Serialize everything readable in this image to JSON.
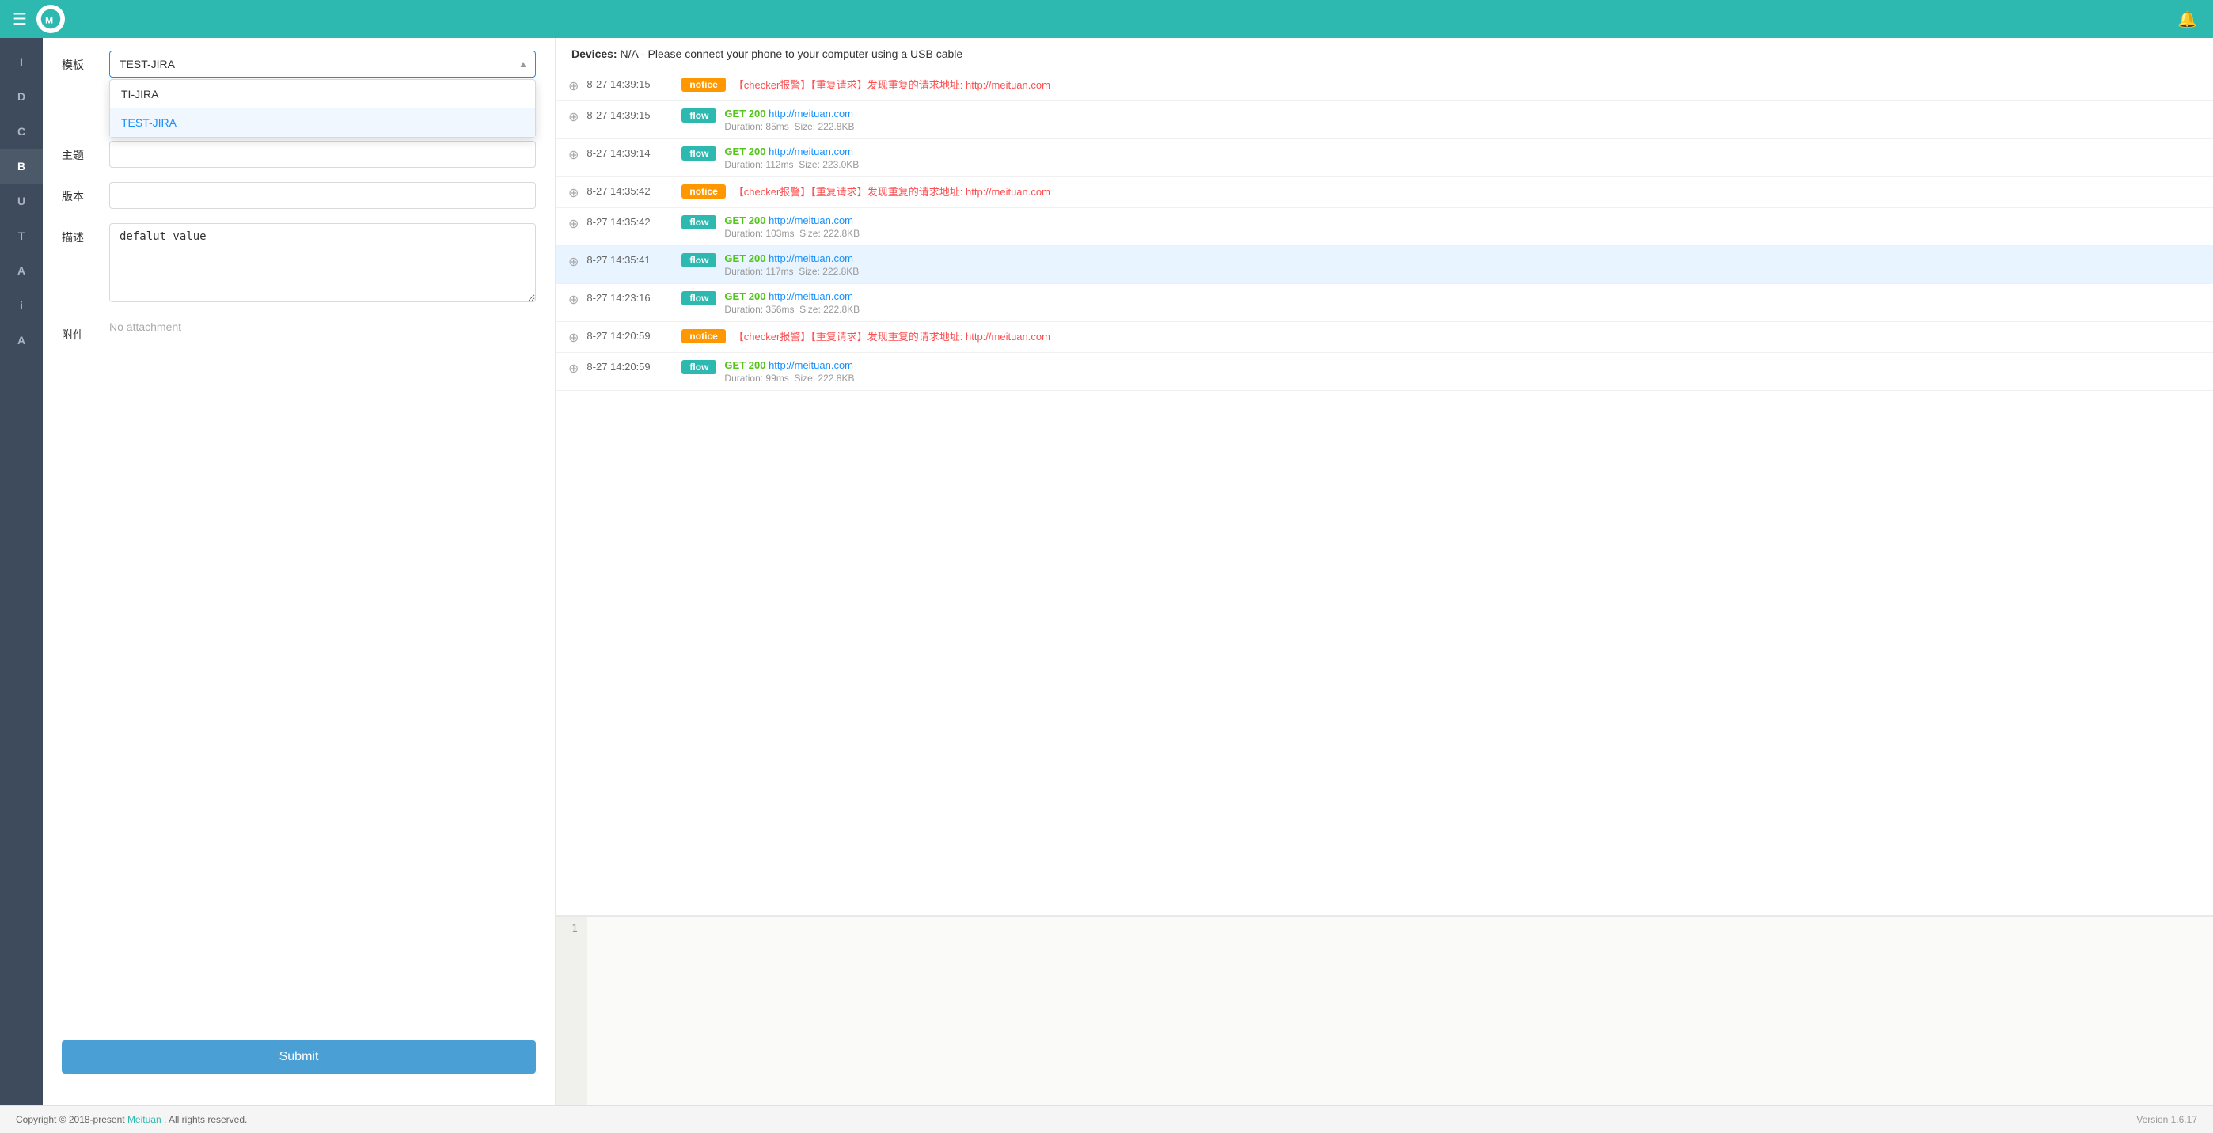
{
  "topbar": {
    "menu_icon": "☰",
    "bell_icon": "🔔"
  },
  "sidebar": {
    "items": [
      {
        "label": "I",
        "id": "i1",
        "active": false
      },
      {
        "label": "D",
        "id": "d",
        "active": false
      },
      {
        "label": "C",
        "id": "c",
        "active": false
      },
      {
        "label": "B",
        "id": "b",
        "active": true
      },
      {
        "label": "U",
        "id": "u",
        "active": false
      },
      {
        "label": "T",
        "id": "t",
        "active": false
      },
      {
        "label": "A",
        "id": "a1",
        "active": false
      },
      {
        "label": "i",
        "id": "i2",
        "active": false
      },
      {
        "label": "A",
        "id": "a2",
        "active": false
      }
    ]
  },
  "form": {
    "template_label": "模板",
    "template_value": "TEST-JIRA",
    "dropdown_items": [
      {
        "label": "TI-JIRA",
        "selected": false
      },
      {
        "label": "TEST-JIRA",
        "selected": true
      }
    ],
    "subject_label": "主题",
    "subject_value": "",
    "version_label": "版本",
    "version_value": "",
    "desc_label": "描述",
    "desc_value": "defalut value",
    "attach_label": "附件",
    "attach_placeholder": "No attachment",
    "submit_label": "Submit"
  },
  "device_bar": {
    "label": "Devices:",
    "message": "N/A - Please connect your phone to your computer using a USB cable"
  },
  "network_items": [
    {
      "id": 1,
      "timestamp": "8-27 14:39:15",
      "badge_type": "notice",
      "badge_label": "notice",
      "is_notice": true,
      "notice_text": "【checker报警】【重复请求】发现重复的请求地址: http://meituan.com",
      "highlighted": false
    },
    {
      "id": 2,
      "timestamp": "8-27 14:39:15",
      "badge_type": "flow",
      "badge_label": "flow",
      "is_notice": false,
      "method": "GET",
      "status": "200",
      "url": "http://meituan.com",
      "duration": "Duration: 85ms",
      "size": "Size: 222.8KB",
      "highlighted": false
    },
    {
      "id": 3,
      "timestamp": "8-27 14:39:14",
      "badge_type": "flow",
      "badge_label": "flow",
      "is_notice": false,
      "method": "GET",
      "status": "200",
      "url": "http://meituan.com",
      "duration": "Duration: 112ms",
      "size": "Size: 223.0KB",
      "highlighted": false
    },
    {
      "id": 4,
      "timestamp": "8-27 14:35:42",
      "badge_type": "notice",
      "badge_label": "notice",
      "is_notice": true,
      "notice_text": "【checker报警】【重复请求】发现重复的请求地址: http://meituan.com",
      "highlighted": false
    },
    {
      "id": 5,
      "timestamp": "8-27 14:35:42",
      "badge_type": "flow",
      "badge_label": "flow",
      "is_notice": false,
      "method": "GET",
      "status": "200",
      "url": "http://meituan.com",
      "duration": "Duration: 103ms",
      "size": "Size: 222.8KB",
      "highlighted": false
    },
    {
      "id": 6,
      "timestamp": "8-27 14:35:41",
      "badge_type": "flow",
      "badge_label": "flow",
      "is_notice": false,
      "method": "GET",
      "status": "200",
      "url": "http://meituan.com",
      "duration": "Duration: 117ms",
      "size": "Size: 222.8KB",
      "highlighted": true
    },
    {
      "id": 7,
      "timestamp": "8-27 14:23:16",
      "badge_type": "flow",
      "badge_label": "flow",
      "is_notice": false,
      "method": "GET",
      "status": "200",
      "url": "http://meituan.com",
      "duration": "Duration: 356ms",
      "size": "Size: 222.8KB",
      "highlighted": false
    },
    {
      "id": 8,
      "timestamp": "8-27 14:20:59",
      "badge_type": "notice",
      "badge_label": "notice",
      "is_notice": true,
      "notice_text": "【checker报警】【重复请求】发现重复的请求地址: http://meituan.com",
      "highlighted": false
    },
    {
      "id": 9,
      "timestamp": "8-27 14:20:59",
      "badge_type": "flow",
      "badge_label": "flow",
      "is_notice": false,
      "method": "GET",
      "status": "200",
      "url": "http://meituan.com",
      "duration": "Duration: 99ms",
      "size": "Size: 222.8KB",
      "highlighted": false
    }
  ],
  "code_panel": {
    "line_number": "1",
    "code": ""
  },
  "footer": {
    "copyright": "Copyright © 2018-present",
    "brand": "Meituan",
    "rights": ". All rights reserved.",
    "version": "Version 1.6.17"
  }
}
